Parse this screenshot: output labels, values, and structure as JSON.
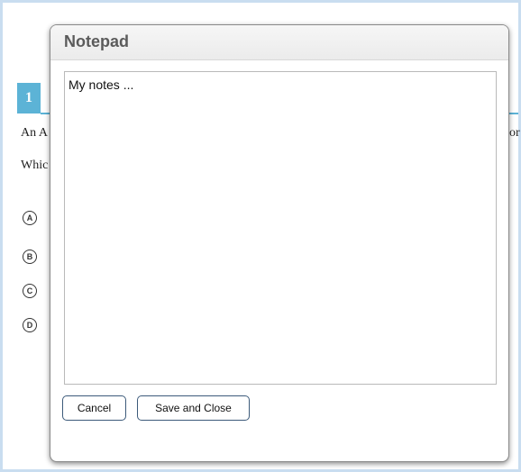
{
  "question": {
    "number": "1",
    "stem_visible_left": "An A",
    "stem_visible_right": "or",
    "ask_visible": "Whic",
    "choices": [
      "A",
      "B",
      "C",
      "D"
    ]
  },
  "notepad": {
    "title": "Notepad",
    "content": "My notes ...",
    "cancel_label": "Cancel",
    "save_close_label": "Save and Close"
  },
  "colors": {
    "accent": "#5cb3d6",
    "frame_border": "#c9ddf0",
    "button_border": "#3c5a7a"
  }
}
